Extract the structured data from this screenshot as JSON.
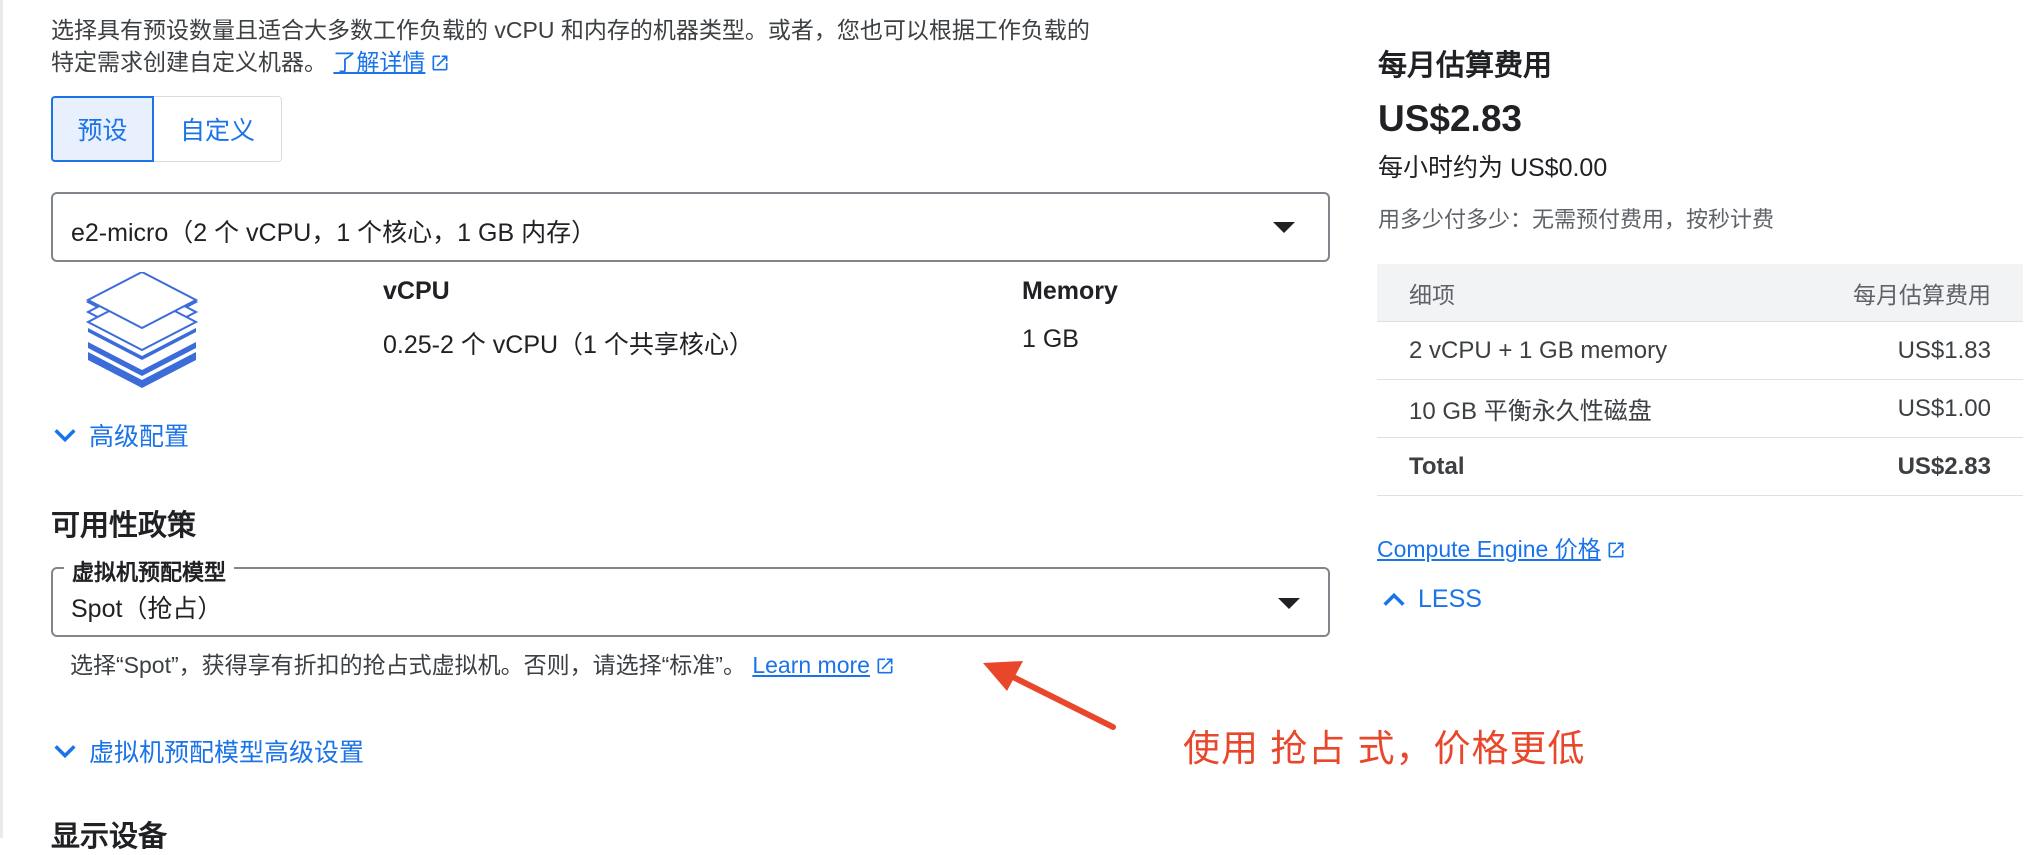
{
  "description": {
    "text": "选择具有预设数量且适合大多数工作负载的 vCPU 和内存的机器类型。或者，您也可以根据工作负载的特定需求创建自定义机器。",
    "learn_more": "了解详情"
  },
  "toggle": {
    "preset": "预设",
    "custom": "自定义"
  },
  "machine_type": {
    "value": "e2-micro（2 个 vCPU，1 个核心，1 GB 内存）"
  },
  "specs": {
    "vcpu_label": "vCPU",
    "vcpu_value": "0.25-2 个 vCPU（1 个共享核心）",
    "memory_label": "Memory",
    "memory_value": "1 GB"
  },
  "advanced_config": "高级配置",
  "availability_policy": {
    "heading": "可用性政策",
    "field_label": "虚拟机预配模型",
    "value": "Spot（抢占）",
    "hint": "选择“Spot”，获得享有折扣的抢占式虚拟机。否则，请选择“标准”。",
    "learn_more": "Learn more",
    "advanced_link": "虚拟机预配模型高级设置"
  },
  "next_section": {
    "heading": "显示设备"
  },
  "cost": {
    "title": "每月估算费用",
    "monthly": "US$2.83",
    "hourly": "每小时约为 US$0.00",
    "note": "用多少付多少：无需预付费用，按秒计费",
    "table": {
      "headers": [
        "细项",
        "每月估算费用"
      ],
      "rows": [
        [
          "2 vCPU + 1 GB memory",
          "US$1.83"
        ],
        [
          "10 GB 平衡永久性磁盘",
          "US$1.00"
        ]
      ],
      "total": [
        "Total",
        "US$2.83"
      ]
    },
    "pricing_link": "Compute Engine 价格",
    "less": "LESS"
  },
  "annotation": {
    "text": "使用 抢占 式，价格更低",
    "color": "#e8472b"
  },
  "colors": {
    "accent": "#1a73e8",
    "annotation": "#e8472b"
  }
}
